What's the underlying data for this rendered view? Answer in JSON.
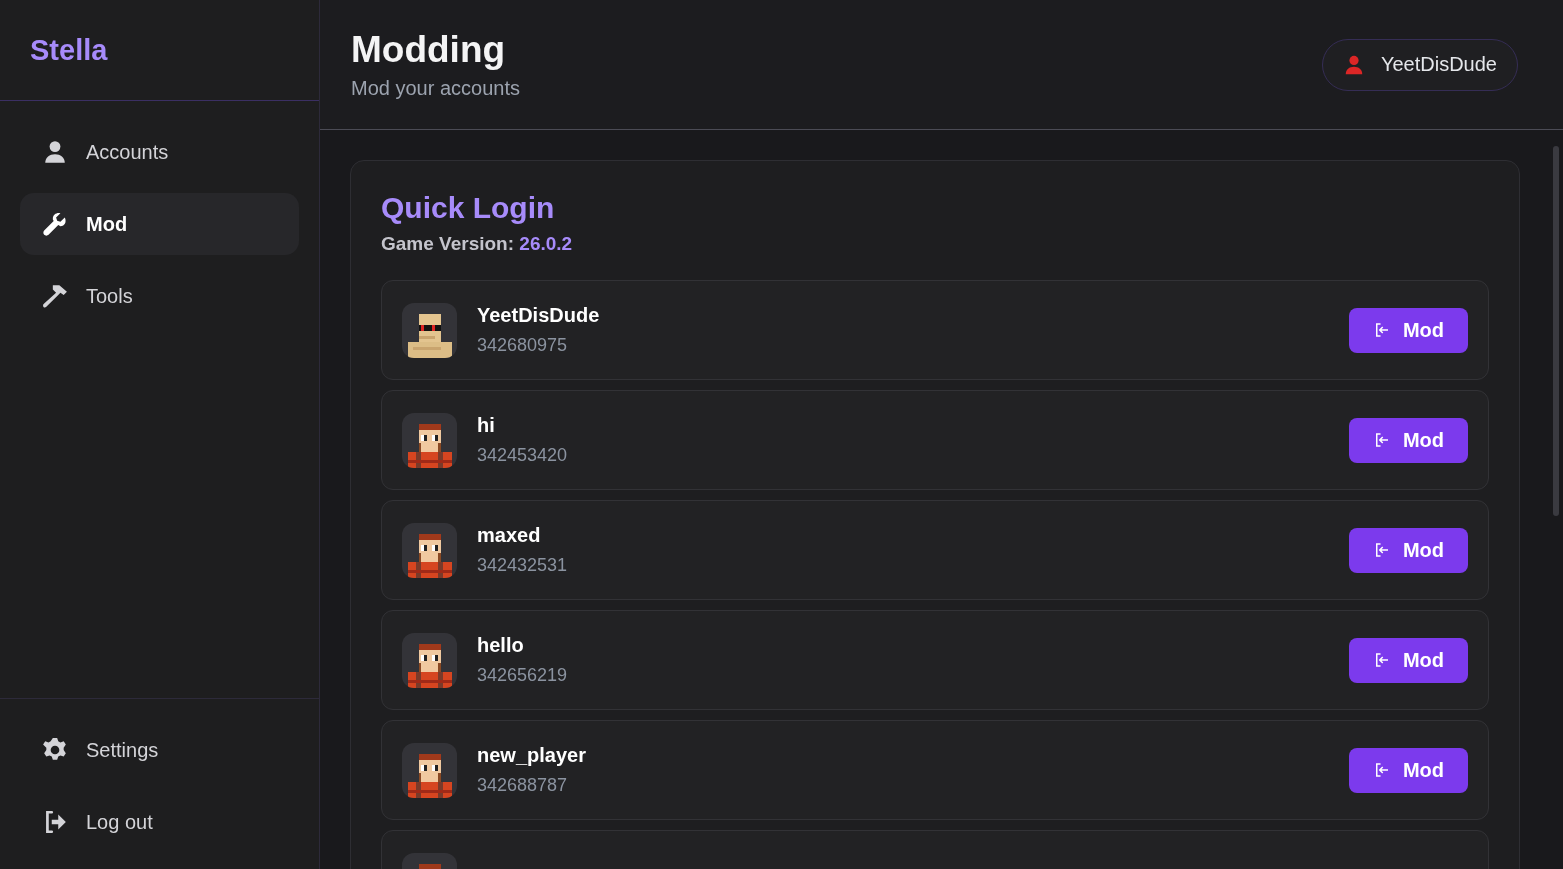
{
  "sidebar": {
    "logo": "Stella",
    "items": [
      {
        "label": "Accounts",
        "selected": false
      },
      {
        "label": "Mod",
        "selected": true
      },
      {
        "label": "Tools",
        "selected": false
      }
    ],
    "footer_items": [
      {
        "label": "Settings"
      },
      {
        "label": "Log out"
      }
    ]
  },
  "header": {
    "title": "Modding",
    "subtitle": "Mod your accounts",
    "user": "YeetDisDude"
  },
  "panel": {
    "title": "Quick Login",
    "version_label": "Game Version:",
    "version": "26.0.2",
    "accounts": [
      {
        "name": "YeetDisDude",
        "id": "342680975",
        "kind": "sand",
        "button": "Mod"
      },
      {
        "name": "hi",
        "id": "342453420",
        "kind": "lumberjack",
        "button": "Mod"
      },
      {
        "name": "maxed",
        "id": "342432531",
        "kind": "lumberjack",
        "button": "Mod"
      },
      {
        "name": "hello",
        "id": "342656219",
        "kind": "lumberjack",
        "button": "Mod"
      },
      {
        "name": "new_player",
        "id": "342688787",
        "kind": "lumberjack",
        "button": "Mod"
      },
      {
        "kind": "lumberjack"
      }
    ]
  }
}
